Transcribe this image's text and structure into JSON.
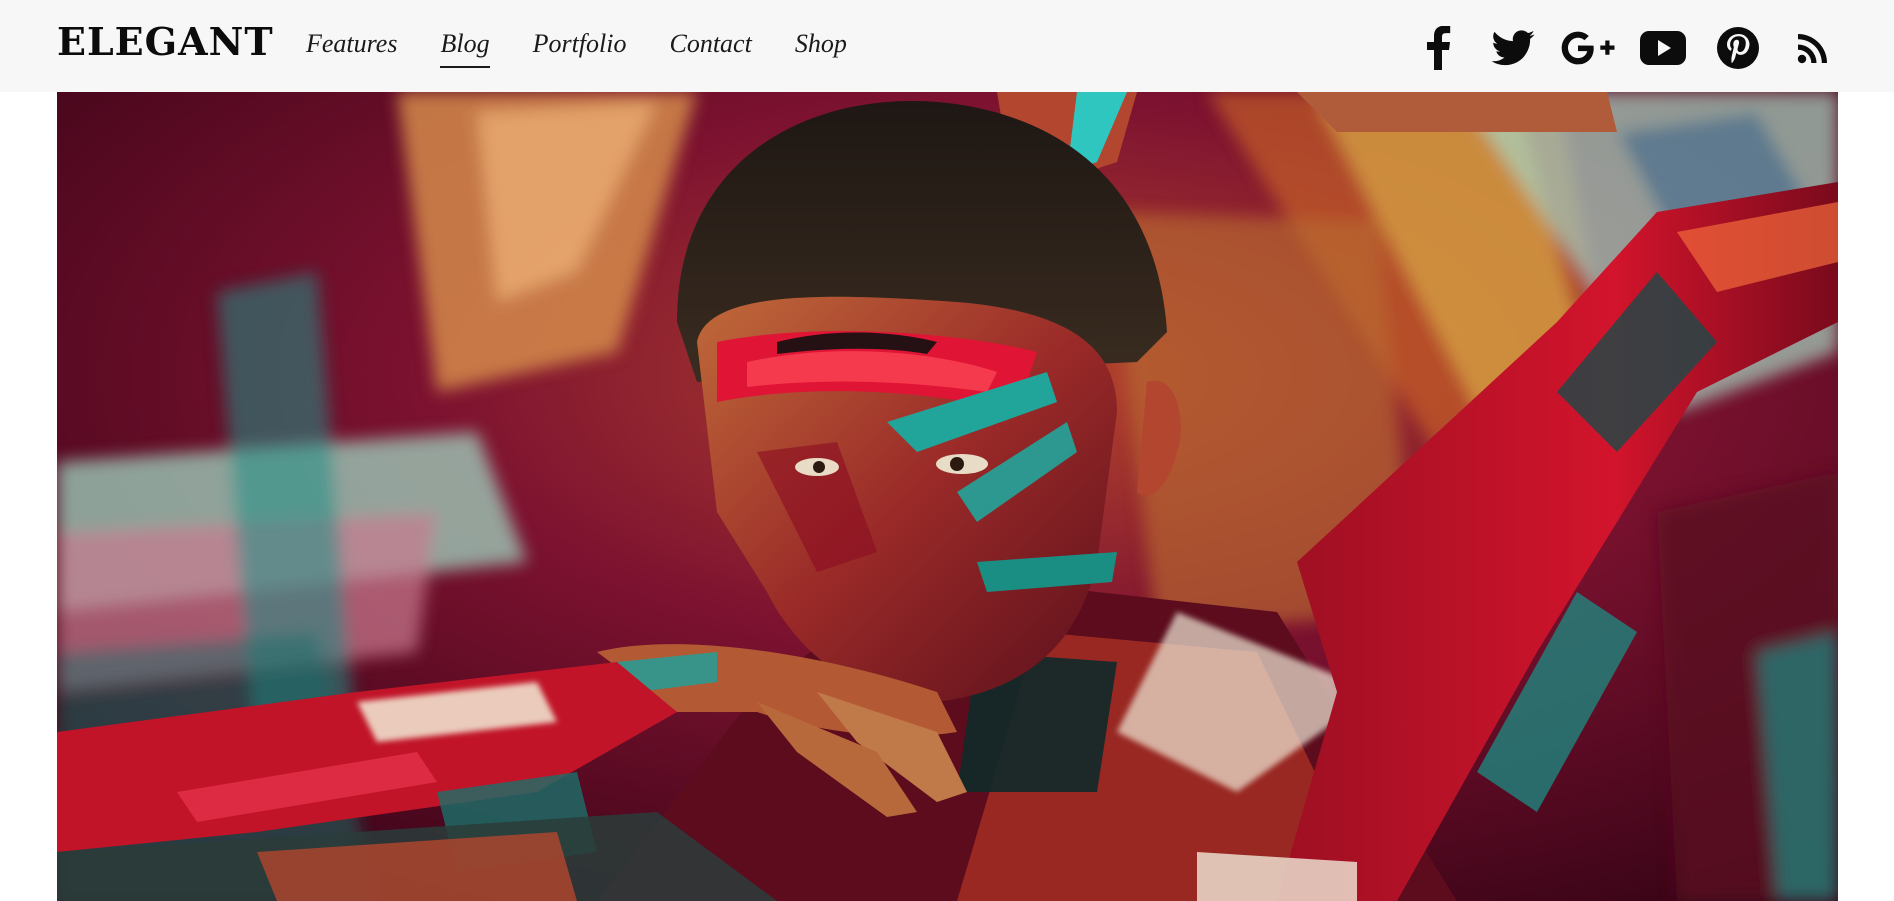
{
  "brand": {
    "logo_text": "ELEGANT"
  },
  "nav": {
    "items": [
      {
        "label": "Features",
        "active": false
      },
      {
        "label": "Blog",
        "active": true
      },
      {
        "label": "Portfolio",
        "active": false
      },
      {
        "label": "Contact",
        "active": false
      },
      {
        "label": "Shop",
        "active": false
      }
    ]
  },
  "social": {
    "icons": [
      "facebook-icon",
      "twitter-icon",
      "google-plus-icon",
      "youtube-icon",
      "pinterest-icon",
      "rss-icon"
    ]
  },
  "colors": {
    "topbar_bg": "#f7f7f7",
    "text": "#1a1a1a",
    "paint_crimson": "#8e0a2e",
    "paint_red": "#d4142c",
    "paint_teal": "#1f9a92",
    "paint_copper": "#c8733a",
    "paint_mint": "#9fd4c0"
  }
}
